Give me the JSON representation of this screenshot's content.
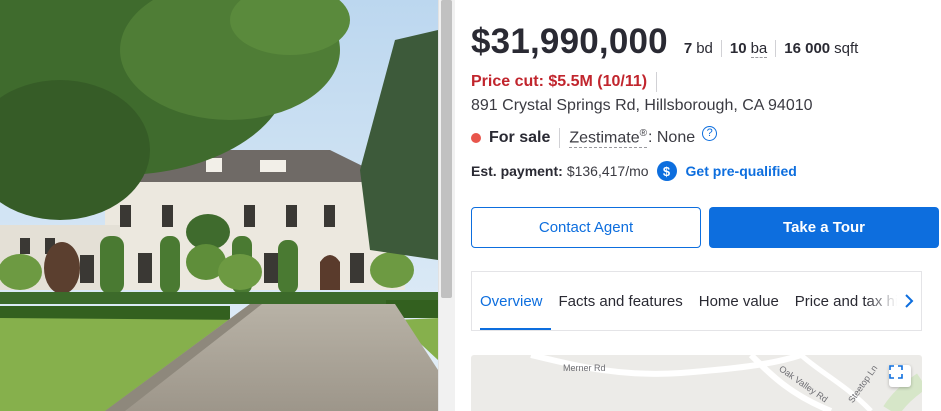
{
  "listing": {
    "price": "$31,990,000",
    "beds_value": "7",
    "beds_unit": "bd",
    "baths_value": "10",
    "baths_unit": "ba",
    "sqft_value": "16 000",
    "sqft_unit": "sqft",
    "price_cut": "Price cut: $5.5M (10/11)",
    "address": "891 Crystal Springs Rd, Hillsborough, CA 94010",
    "status": "For sale",
    "zestimate_label": "Zestimate",
    "zestimate_reg": "®",
    "zestimate_value": ": None",
    "help_glyph": "?",
    "payment_label": "Est. payment:",
    "payment_value": "$136,417/mo",
    "dollar_glyph": "$",
    "prequalify_label": "Get pre-qualified"
  },
  "actions": {
    "contact_label": "Contact Agent",
    "tour_label": "Take a Tour"
  },
  "tabs": [
    {
      "label": "Overview",
      "active": true
    },
    {
      "label": "Facts and features",
      "active": false
    },
    {
      "label": "Home value",
      "active": false
    },
    {
      "label": "Price and tax history",
      "active": false
    }
  ],
  "map": {
    "labels": [
      "Merner Rd",
      "Oak Valley Rd",
      "Steetop Ln"
    ]
  },
  "colors": {
    "accent": "#0d6ede",
    "price_cut": "#c1252d",
    "status_dot": "#e8554b"
  },
  "icons": {
    "status": "status-dot",
    "zestimate_help": "help-circle-icon",
    "payment": "dollar-circle-icon",
    "tabs_next": "chevron-right-icon",
    "map_expand": "expand-icon"
  }
}
